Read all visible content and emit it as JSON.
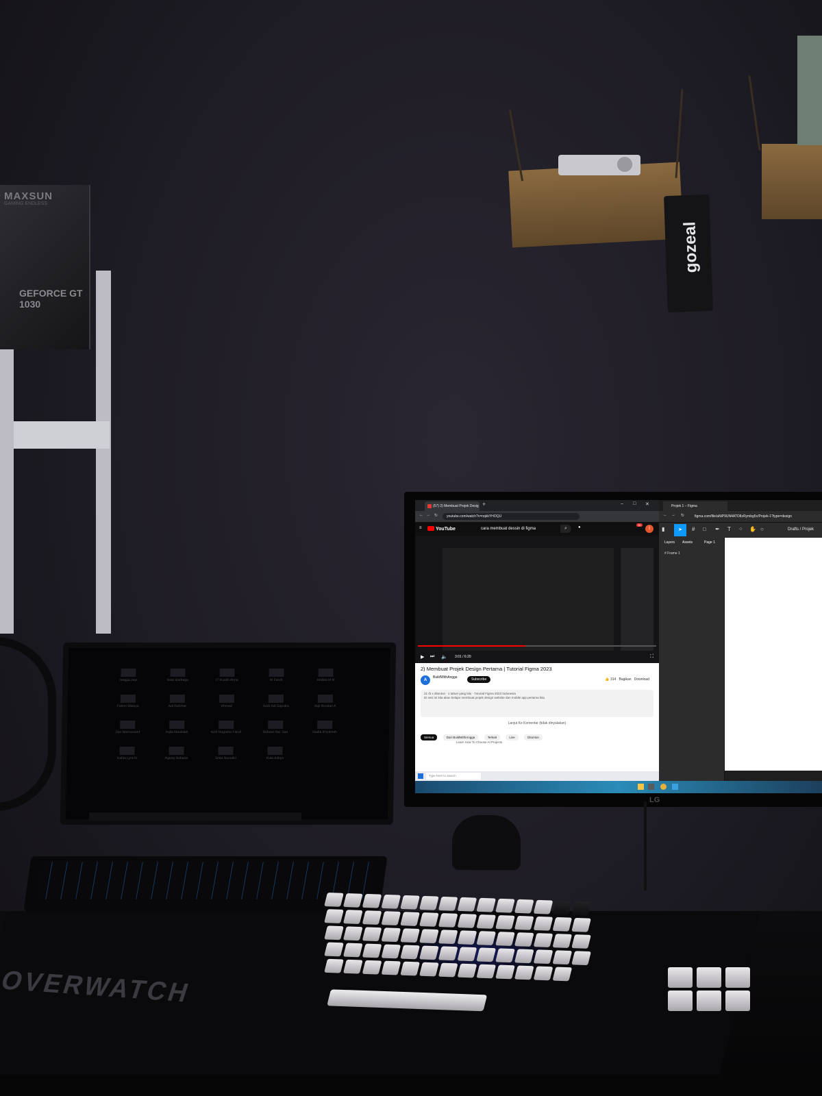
{
  "photo": {
    "kind": "dimly lit desk setup photo",
    "colors": {
      "wall": "#24212b",
      "desk": "#08080a",
      "keyboard_keys": "#d8d6da",
      "laptop_backlight": "#1b5fa8",
      "youtube_red": "#ff0000",
      "figma_blue": "#0d99ff"
    }
  },
  "gpu_box": {
    "brand": "MAXSUN",
    "subtitle": "GAMING ENDLESS",
    "model": "GEFORCE GT 1030"
  },
  "wall_tag": {
    "text": "gozeal"
  },
  "mousepad": {
    "text": "OVERWATCH"
  },
  "monitor": {
    "brand": "LG"
  },
  "chrome": {
    "tab_title": "(57) 2) Membuat Projek Desig",
    "url": "youtube.com/watch?v=nqkkYHOQU",
    "youtube": {
      "logo": "YouTube",
      "search_query": "cara membuat dessin di figma",
      "notification_count": "9+",
      "avatar_letter": "I",
      "player_time": "3:01 / 6:20",
      "video_title": "2) Membuat Projek Design Pertama | Tutorial Figma 2023",
      "channel_name": "BuildWithAngga",
      "subscribe_label": "Subscribe",
      "like_count": "314",
      "share_label": "Bagikan",
      "download_label": "Download",
      "description_line1": "21 rb x ditonton · 1 tahun yang lalu · Tutorial Figma 2023 Indonesia",
      "description_line2": "Di sesi ini kita akan belajar membuat projek design website dan mobile app pertama kita",
      "comments_label": "Lanjut Ke Komentar (tidak dinyalakan)",
      "chips": [
        "Semua",
        "Dari BuildWithAngga",
        "Terkait",
        "Live",
        "Ditonton"
      ],
      "suggestion": "Learn How To Choose AI Projects",
      "taskbar_search": "Type here to search"
    }
  },
  "figma": {
    "tab_title": "Projek 1 – Figma",
    "url": "figma.com/file/aNiP9UN4ATO8zRymbg5c/Projek-1?type=design",
    "left_tabs": [
      "Layers",
      "Assets"
    ],
    "page": "Page 1",
    "frame": "Frame 1",
    "drafts": "Drafts / Projek"
  },
  "laptop": {
    "tiles": [
      "rangga.zayr",
      "Iwan Barbaga",
      "IT Kuskh Abna",
      "M Faruh",
      "Andika M R",
      "Fahmi Waluyo",
      "Adi Rahmat",
      "Ahmad",
      "Azzil Adi Saputra",
      "Aqil Rosdan A",
      "Jeje Nasruzzard",
      "Aqila Maulidah",
      "Azril Nugraha Faruh",
      "Ridwan Nur Sae",
      "Nadia Khotimah",
      "Kahla Lyra N",
      "Agung Nobana",
      "Sinta Nursalsi",
      "Kuta Aditya"
    ]
  }
}
